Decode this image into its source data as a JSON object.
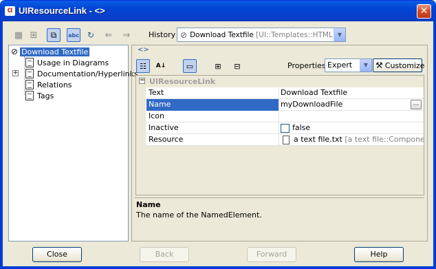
{
  "window": {
    "title": "UIResourceLink - <>",
    "icon_text": "Ɑ"
  },
  "toolbar": {
    "history_label": "History :",
    "history_value": "Download Textfile",
    "history_value_suffix": " [UI::Templates::HTML]",
    "icons": [
      "grid-icon",
      "hierarchy-icon",
      "new-window-icon",
      "abc-icon",
      "refresh-icon",
      "back-arrow-icon",
      "forward-arrow-icon"
    ]
  },
  "tree": {
    "root": "Download Textfile",
    "children": [
      {
        "label": "Usage in Diagrams",
        "expandable": false
      },
      {
        "label": "Documentation/Hyperlinks",
        "expandable": true
      },
      {
        "label": "Relations",
        "expandable": false
      },
      {
        "label": "Tags",
        "expandable": false
      }
    ]
  },
  "details": {
    "crumb": "<>",
    "properties_label": "Properties:",
    "properties_value": "Expert",
    "customize_label": "Customize",
    "group_header": "UIResourceLink",
    "rows": [
      {
        "key": "Text",
        "value": "Download Textfile"
      },
      {
        "key": "Name",
        "value": "myDownloadFile"
      },
      {
        "key": "Icon",
        "value": ""
      },
      {
        "key": "Inactive",
        "value": "false"
      },
      {
        "key": "Resource",
        "value": "a text file.txt",
        "value_suffix": " [a text file::Compone..."
      }
    ],
    "description_name": "Name",
    "description_text": "The name of the NamedElement."
  },
  "buttons": {
    "close": "Close",
    "back": "Back",
    "forward": "Forward",
    "help": "Help"
  }
}
